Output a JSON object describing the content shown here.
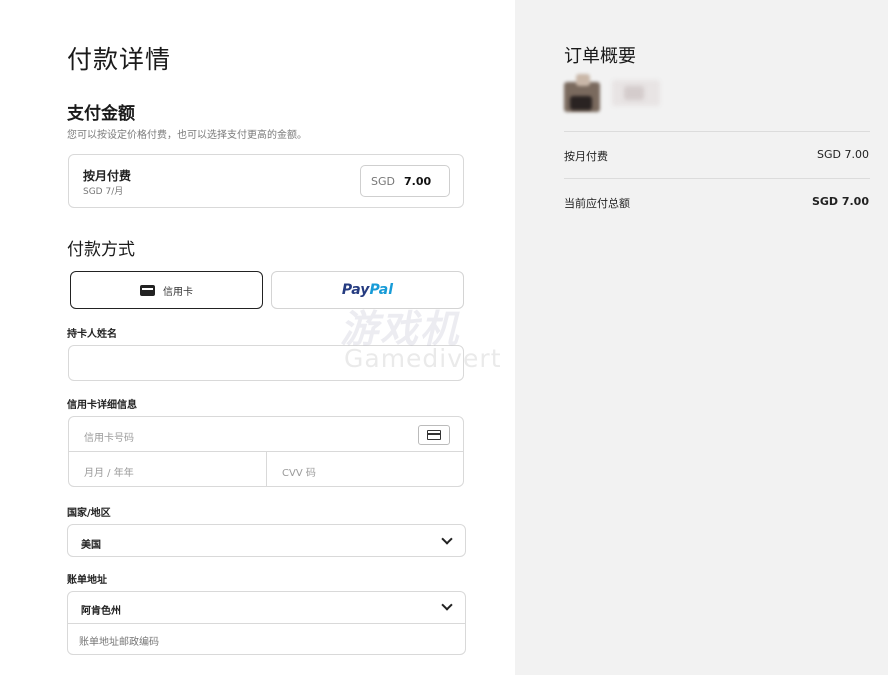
{
  "page": {
    "title": "付款详情"
  },
  "amount": {
    "title": "支付金额",
    "subtitle": "您可以按设定价格付费，也可以选择支付更高的金额。",
    "plan_name": "按月付费",
    "plan_price": "SGD 7/月",
    "currency": "SGD",
    "value": "7.00"
  },
  "payment_method": {
    "title": "付款方式",
    "card_label": "信用卡",
    "paypal_part1": "Pay",
    "paypal_part2": "Pal"
  },
  "cardholder": {
    "label": "持卡人姓名",
    "value": ""
  },
  "card_details": {
    "label": "信用卡详细信息",
    "number_placeholder": "信用卡号码",
    "expiry_placeholder": "月月 / 年年",
    "cvv_placeholder": "CVV 码"
  },
  "country": {
    "label": "国家/地区",
    "selected": "美国"
  },
  "billing": {
    "label": "账单地址",
    "state_selected": "阿肯色州",
    "zip_placeholder": "账单地址邮政编码"
  },
  "summary": {
    "title": "订单概要",
    "row1_label": "按月付费",
    "row1_value": "SGD 7.00",
    "total_label": "当前应付总额",
    "total_value": "SGD 7.00"
  },
  "watermark": {
    "cn": "游戏机",
    "en": "Gamedivert"
  },
  "colors": {
    "summary_bg": "#f2f2f2",
    "paypal_dark": "#253b80",
    "paypal_light": "#179bd7"
  },
  "icons": [
    "credit-card-icon",
    "chevron-down-icon"
  ]
}
